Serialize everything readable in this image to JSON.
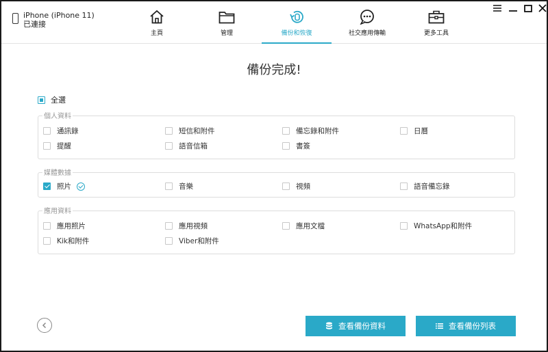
{
  "device": {
    "name": "iPhone (iPhone 11)",
    "status": "已連接"
  },
  "nav": {
    "tabs": [
      {
        "label": "主頁",
        "icon": "home-icon"
      },
      {
        "label": "管理",
        "icon": "folder-icon"
      },
      {
        "label": "備份和恢復",
        "icon": "backup-restore-icon",
        "active": true
      },
      {
        "label": "社交應用傳輸",
        "icon": "chat-icon"
      },
      {
        "label": "更多工具",
        "icon": "toolbox-icon"
      }
    ]
  },
  "window": {
    "menu_icon": "menu-icon",
    "minimize_icon": "minimize-icon",
    "maximize_icon": "maximize-icon",
    "close_icon": "close-icon"
  },
  "main": {
    "title": "備份完成!",
    "select_all": "全選",
    "groups": [
      {
        "label": "個人資料",
        "items": [
          "通訊錄",
          "短信和附件",
          "備忘錄和附件",
          "日曆",
          "提醒",
          "語音信箱",
          "書簽"
        ]
      },
      {
        "label": "媒體數據",
        "items": [
          "照片",
          "音樂",
          "視頻",
          "語音備忘錄"
        ]
      },
      {
        "label": "應用資料",
        "items": [
          "應用照片",
          "應用視頻",
          "應用文檔",
          "WhatsApp和附件",
          "Kik和附件",
          "Viber和附件"
        ]
      }
    ]
  },
  "footer": {
    "back_icon": "back-icon",
    "view_backup_data": "查看備份資料",
    "view_backup_list": "查看備份列表"
  },
  "colors": {
    "accent": "#2aa9c8"
  }
}
